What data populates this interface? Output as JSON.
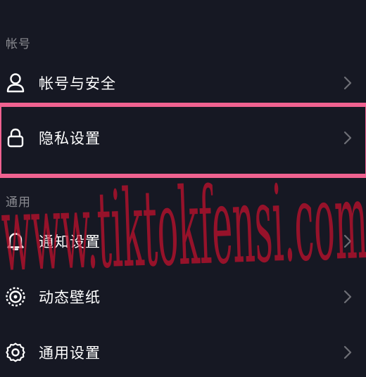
{
  "sections": {
    "account": {
      "title": "帐号"
    },
    "general": {
      "title": "通用"
    }
  },
  "items": [
    {
      "label": "帐号与安全",
      "icon": "user-icon"
    },
    {
      "label": "隐私设置",
      "icon": "lock-icon"
    },
    {
      "label": "通知设置",
      "icon": "bell-icon"
    },
    {
      "label": "动态壁纸",
      "icon": "live-wallpaper-icon"
    },
    {
      "label": "通用设置",
      "icon": "gear-icon"
    }
  ],
  "watermark": {
    "text": "www.tiktokfensi.com",
    "color": "#c8102e"
  },
  "colors": {
    "background": "#161823",
    "highlight": "#f06290",
    "text": "#ffffff",
    "section_text": "#8a8b91",
    "chevron": "#6e6f76"
  }
}
